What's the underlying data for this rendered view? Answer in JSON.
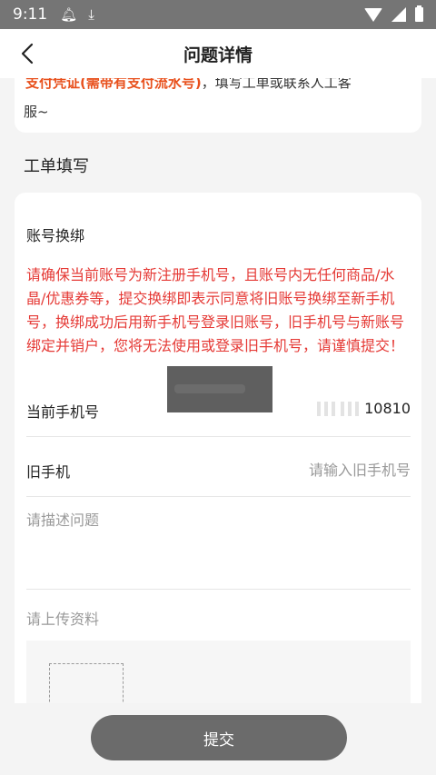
{
  "status_bar": {
    "time": "9:11",
    "icons": [
      "notification-bell-icon",
      "download-icon",
      "wifi-icon",
      "signal-icon",
      "battery-icon"
    ]
  },
  "header": {
    "title": "问题详情",
    "back_icon": "chevron-left-icon"
  },
  "notice": {
    "highlight": "支付凭证(需带有支付流水号)",
    "rest": "，填写工单或联系人工客",
    "line2": "服~"
  },
  "form_section": {
    "title": "工单填写"
  },
  "form": {
    "type_label": "账号换绑",
    "warning": "请确保当前账号为新注册手机号，且账号内无任何商品/水晶/优惠券等，提交换绑即表示同意将旧账号换绑至新手机号，换绑成功后用新手机号登录旧账号，旧手机号与新账号绑定并销户，您将无法使用或登录旧手机号，请谨慎提交！",
    "current_phone_label": "当前手机号",
    "current_phone_value": "10810",
    "old_phone_label": "旧手机",
    "old_phone_placeholder": "请输入旧手机号",
    "old_phone_value": "",
    "description_placeholder": "请描述问题",
    "upload_label": "请上传资料",
    "upload_plus": "+"
  },
  "footer": {
    "submit_label": "提交"
  },
  "colors": {
    "warning_red": "#e53935",
    "notice_orange": "#e8501c",
    "submit_bg": "#6b6b6b",
    "status_bar_bg": "#757575"
  }
}
